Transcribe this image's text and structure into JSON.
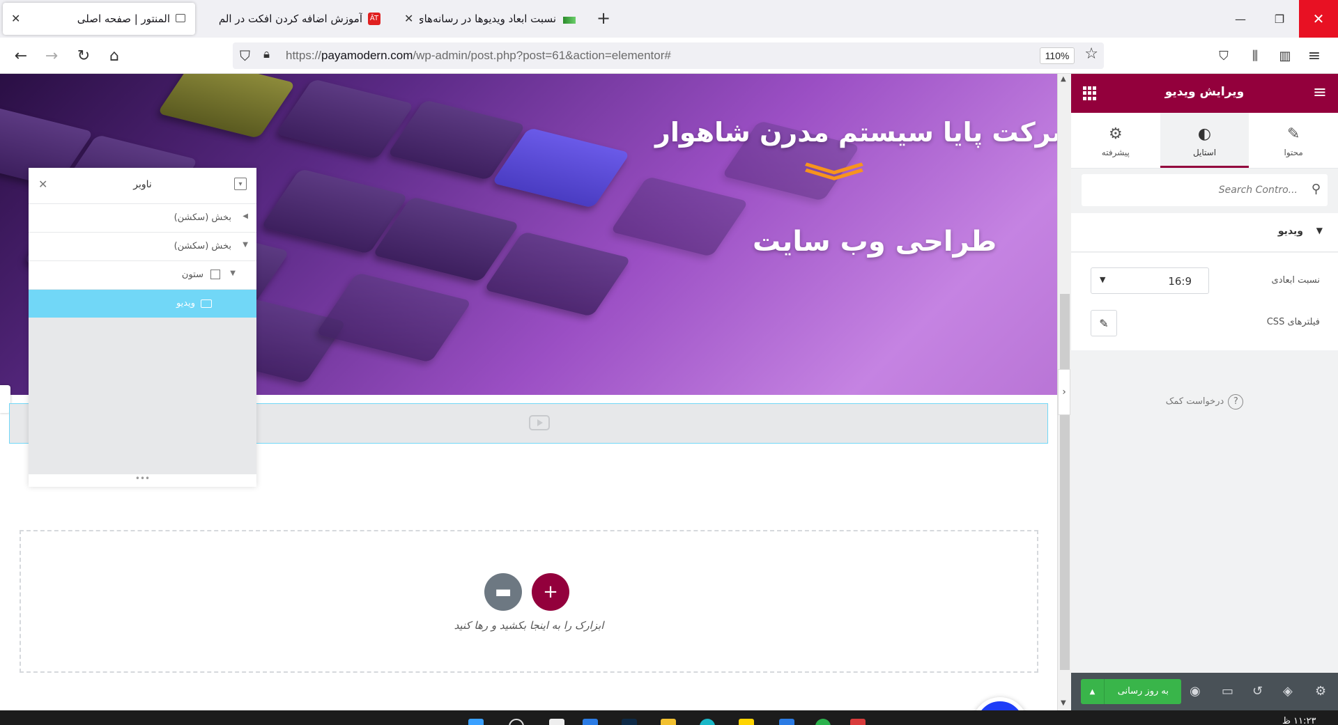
{
  "browser": {
    "tabs": [
      {
        "label": "المنتور | صفحه اصلی",
        "active": true
      },
      {
        "label": "آموزش اضافه کردن افکت در الم",
        "active": false
      },
      {
        "label": "نسبت ابعاد ویدیوها در رسانه‌های",
        "active": false
      }
    ],
    "url_domain": "payamodern.com",
    "url_prefix": "https://",
    "url_path": "/wp-admin/post.php?post=61&action=elementor#",
    "zoom": "110%"
  },
  "hero": {
    "title": "شرکت پایا سیستم مدرن شاهوار",
    "subtitle": "طراحی وب سایت"
  },
  "dropzone": {
    "hint": "ابزارک را به اینجا بکشید و رها کنید"
  },
  "navigator": {
    "title": "ناوبر",
    "items": [
      {
        "label": "بخش (سکشن)",
        "state": "collapsed"
      },
      {
        "label": "بخش (سکشن)",
        "state": "expanded"
      },
      {
        "label": "ستون",
        "state": "expanded"
      },
      {
        "label": "ویدیو",
        "state": "selected"
      }
    ]
  },
  "panel": {
    "title": "ویرایش ویدیو",
    "tabs": [
      {
        "label": "محتوا",
        "icon": "pencil-icon"
      },
      {
        "label": "استایل",
        "icon": "contrast-icon",
        "active": true
      },
      {
        "label": "پیشرفته",
        "icon": "gear-icon"
      }
    ],
    "search_placeholder": "Search Contro...",
    "section_title": "ویدیو",
    "aspect_label": "نسبت ابعادی",
    "aspect_value": "16:9",
    "css_filters_label": "فیلترهای CSS",
    "help_label": "درخواست کمک",
    "publish_label": "به روز رسانی"
  },
  "colors": {
    "brand": "#93003c",
    "accent_blue": "#71d7f7",
    "publish_green": "#39b54a",
    "chevron_orange": "#f7941d"
  },
  "taskbar": {
    "clock": "۱۱:۲۳ ظ"
  }
}
